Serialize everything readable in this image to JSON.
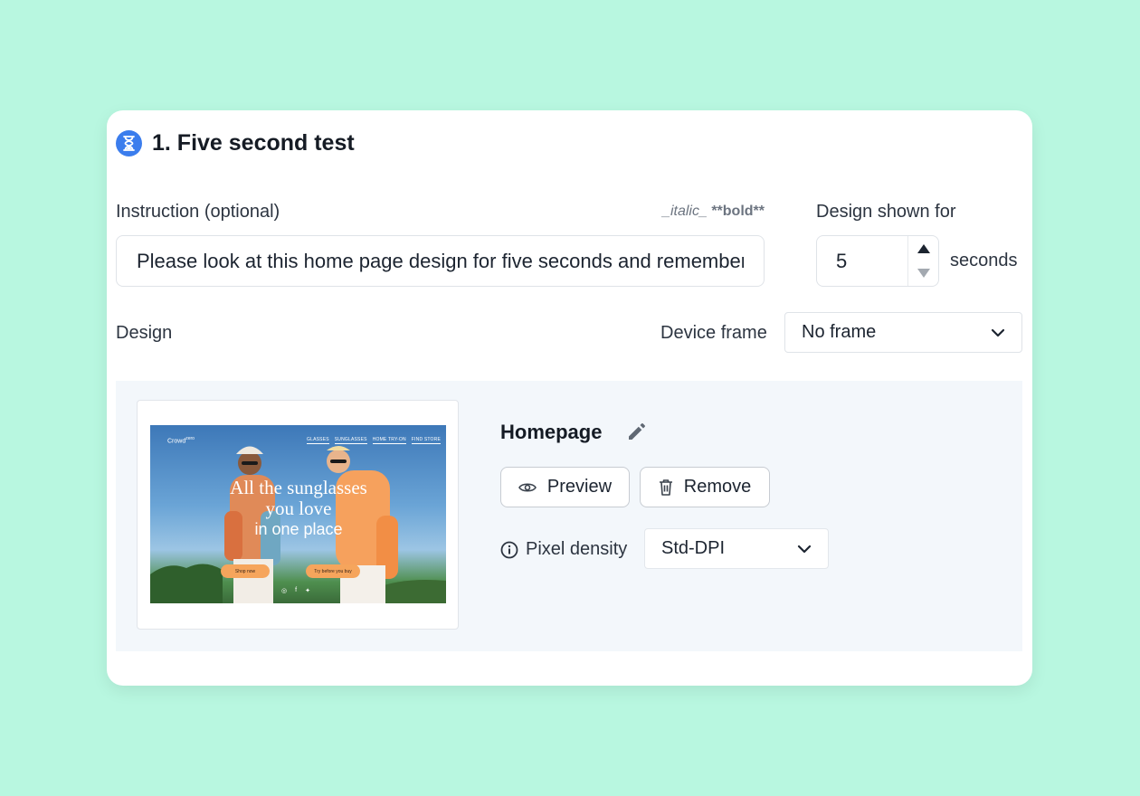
{
  "question": {
    "title": "1. Five second test",
    "icon": "hourglass-icon"
  },
  "instruction": {
    "label": "Instruction (optional)",
    "markdown_hint_italic": "_italic_",
    "markdown_hint_bold": "**bold**",
    "value": "Please look at this home page design for five seconds and remember as much as you can."
  },
  "duration": {
    "label": "Design shown for",
    "value": "5",
    "unit": "seconds"
  },
  "design_section": {
    "label": "Design",
    "device_frame_label": "Device frame",
    "device_frame_value": "No frame"
  },
  "design_item": {
    "name": "Homepage",
    "preview_label": "Preview",
    "remove_label": "Remove",
    "pixel_density_label": "Pixel density",
    "pixel_density_value": "Std-DPI"
  },
  "thumbnail": {
    "brand": "Crowd",
    "brand_suffix": "zero",
    "nav": [
      "GLASSES",
      "SUNGLASSES",
      "HOME TRY-ON",
      "FIND STORE"
    ],
    "hero_line1": "All the sunglasses",
    "hero_line2": "you love",
    "hero_line3": "in one place",
    "cta_primary": "Shop now",
    "cta_secondary": "Try before you buy"
  },
  "colors": {
    "background": "#b8f7e0",
    "accent": "#3b7ded",
    "panel": "#f3f7fb"
  }
}
